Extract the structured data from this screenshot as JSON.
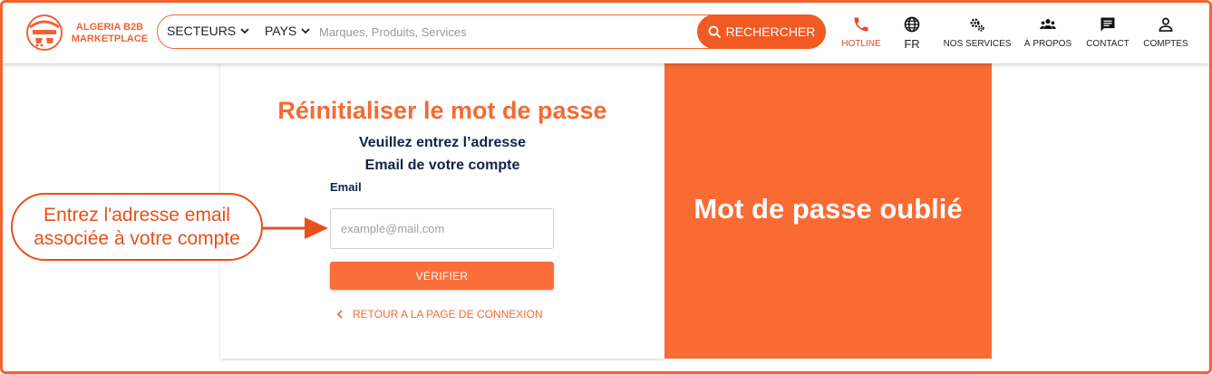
{
  "brand": {
    "line1": "ALGERIA B2B",
    "line2": "MARKETPLACE",
    "accent": "#f15a22"
  },
  "search": {
    "dropdown_sectors": "SECTEURS",
    "dropdown_countries": "PAYS",
    "placeholder": "Marques, Produits, Services",
    "button_label": "RECHERCHER"
  },
  "nav": {
    "hotline": "HOTLINE",
    "language": "FR",
    "services": "NOS SERVICES",
    "about": "À PROPOS",
    "contact": "CONTACT",
    "accounts": "COMPTES"
  },
  "form": {
    "title": "Réinitialiser le mot de passe",
    "subtitle_line1": "Veuillez entrez l’adresse",
    "subtitle_line2": "Email de votre compte",
    "email_label": "Email",
    "email_placeholder": "example@mail.com",
    "verify_button": "VÉRIFIER",
    "back_link": "RETOUR A LA PAGE DE CONNEXION"
  },
  "side_panel": {
    "title": "Mot de passe oublié",
    "color": "#fa6a33"
  },
  "annotation": {
    "line1": "Entrez l'adresse email",
    "line2": "associée à votre compte"
  }
}
